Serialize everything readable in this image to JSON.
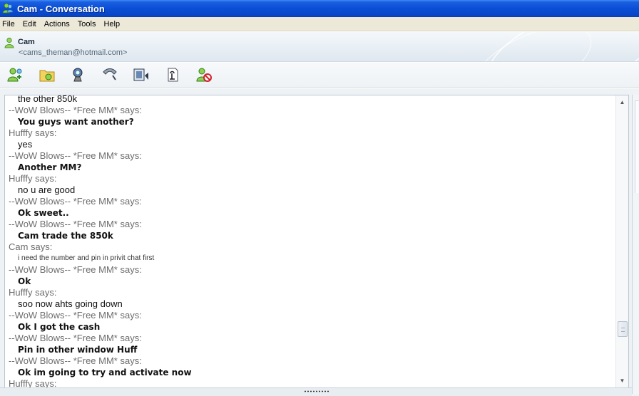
{
  "window": {
    "title": "Cam - Conversation"
  },
  "menu": {
    "items": [
      "File",
      "Edit",
      "Actions",
      "Tools",
      "Help"
    ]
  },
  "contact": {
    "name": "Cam",
    "email": "<cams_theman@hotmail.com>"
  },
  "toolbar": {
    "buttons": [
      {
        "icon": "invite-contact-icon"
      },
      {
        "icon": "send-files-icon"
      },
      {
        "icon": "voice-call-icon"
      },
      {
        "icon": "phone-call-icon"
      },
      {
        "icon": "video-icon"
      },
      {
        "icon": "activities-icon"
      },
      {
        "icon": "block-contact-icon"
      }
    ]
  },
  "conversation": {
    "lines": [
      {
        "type": "text",
        "text": "the other 850k"
      },
      {
        "type": "says",
        "text": "--WoW Blows-- *Free MM* says:"
      },
      {
        "type": "text-bold",
        "text": "You guys want another?"
      },
      {
        "type": "says",
        "text": "Hufffy says:"
      },
      {
        "type": "text",
        "text": "yes"
      },
      {
        "type": "says",
        "text": "--WoW Blows-- *Free MM* says:"
      },
      {
        "type": "text-bold",
        "text": "Another MM?"
      },
      {
        "type": "says",
        "text": "Hufffy says:"
      },
      {
        "type": "text",
        "text": "no u are good"
      },
      {
        "type": "says",
        "text": "--WoW Blows-- *Free MM* says:"
      },
      {
        "type": "text-bold",
        "text": "Ok sweet.."
      },
      {
        "type": "says",
        "text": "--WoW Blows-- *Free MM* says:"
      },
      {
        "type": "text-bold",
        "text": "Cam trade the 850k"
      },
      {
        "type": "says",
        "text": "Cam says:"
      },
      {
        "type": "text-tiny",
        "text": "i need the number and pin in privit chat first"
      },
      {
        "type": "says",
        "text": "--WoW Blows-- *Free MM* says:"
      },
      {
        "type": "text-bold",
        "text": "Ok"
      },
      {
        "type": "says",
        "text": "Hufffy says:"
      },
      {
        "type": "text",
        "text": "soo now ahts going down"
      },
      {
        "type": "says",
        "text": "--WoW Blows-- *Free MM* says:"
      },
      {
        "type": "text-bold",
        "text": "Ok I got the cash"
      },
      {
        "type": "says",
        "text": "--WoW Blows-- *Free MM* says:"
      },
      {
        "type": "text-bold",
        "text": "Pin in other window Huff"
      },
      {
        "type": "says",
        "text": "--WoW Blows-- *Free MM* says:"
      },
      {
        "type": "text-bold",
        "text": "Ok im going to try and activate now"
      },
      {
        "type": "says",
        "text": "Hufffy says:"
      }
    ]
  },
  "scrollbar": {
    "position_fraction": 0.86
  },
  "colors": {
    "title_bar": "#0a4ed6",
    "menu_bar": "#ece9d8",
    "says_text": "#6d6d6d"
  }
}
